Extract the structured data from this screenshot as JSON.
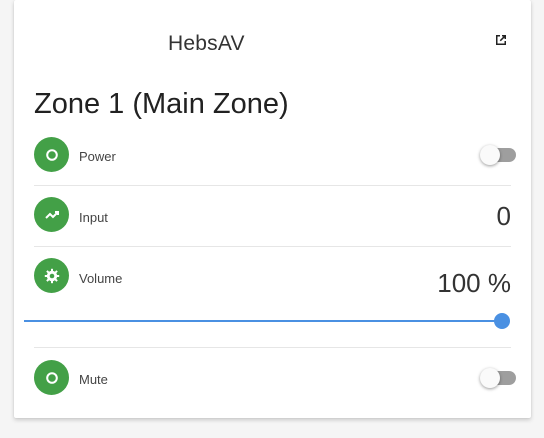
{
  "card": {
    "title": "HebsAV",
    "open_icon": "open-in-new-icon"
  },
  "zone": {
    "title": "Zone 1 (Main Zone)"
  },
  "rows": {
    "power": {
      "label": "Power",
      "icon": "power-circle-icon",
      "state": "off"
    },
    "input": {
      "label": "Input",
      "icon": "trend-icon",
      "value": "0"
    },
    "volume": {
      "label": "Volume",
      "icon": "gear-icon",
      "value": "100 %",
      "level_percent": 100
    },
    "mute": {
      "label": "Mute",
      "icon": "power-circle-icon",
      "state": "off"
    }
  },
  "colors": {
    "badge": "#43a047",
    "slider": "#4a90e2",
    "toggle_off_track": "#9e9e9e"
  }
}
